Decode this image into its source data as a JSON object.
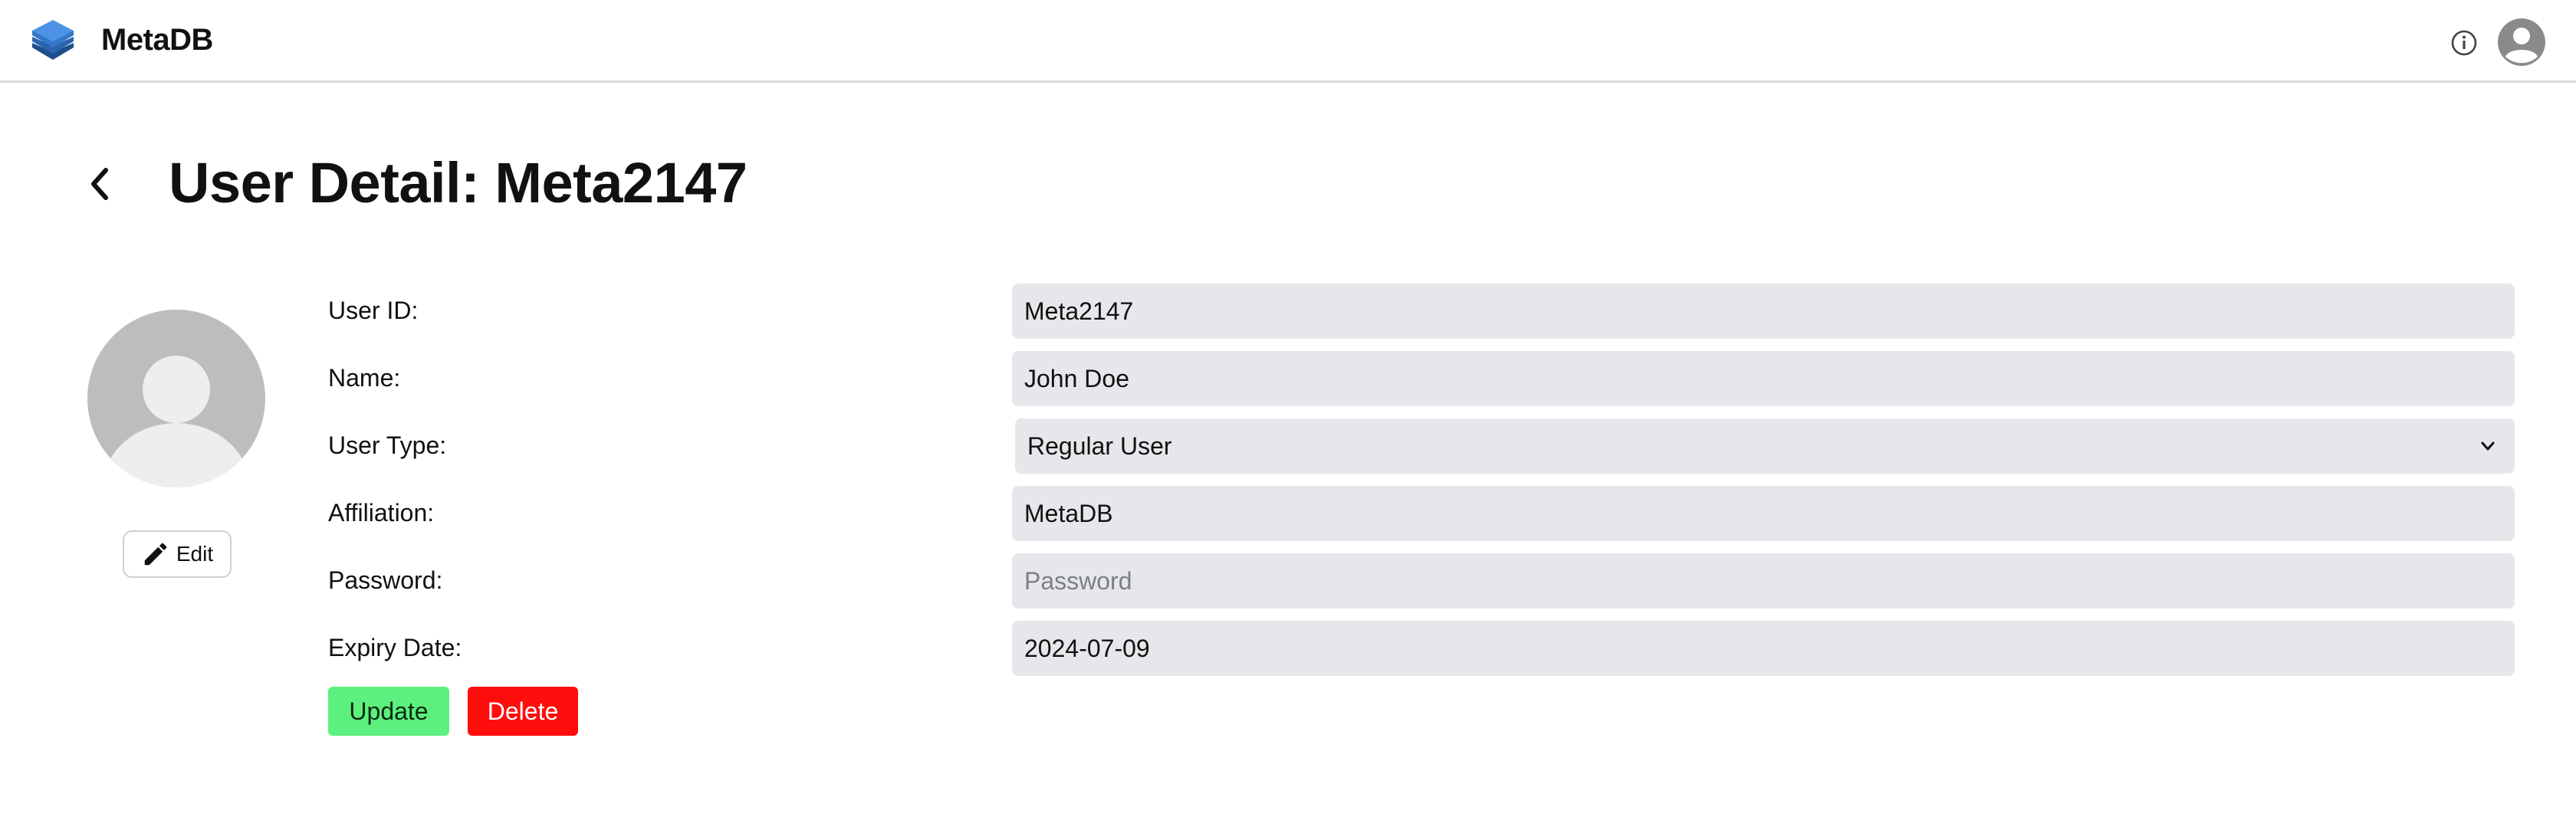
{
  "app": {
    "title": "MetaDB",
    "logo_icon": "layers-stack-icon",
    "brand_color": "#3a7bd5"
  },
  "header": {
    "info_icon": "info-circle-icon",
    "account_icon": "account-avatar-icon"
  },
  "page": {
    "title": "User Detail: Meta2147",
    "back_icon": "chevron-left-icon"
  },
  "profile": {
    "avatar_icon": "user-avatar-placeholder-icon",
    "edit_label": "Edit",
    "edit_icon": "pencil-icon"
  },
  "form": {
    "user_id": {
      "label": "User ID:",
      "value": "Meta2147"
    },
    "name": {
      "label": "Name:",
      "value": "John Doe"
    },
    "user_type": {
      "label": "User Type:",
      "value": "Regular User",
      "icon": "chevron-down-icon"
    },
    "affiliation": {
      "label": "Affiliation:",
      "value": "MetaDB"
    },
    "password": {
      "label": "Password:",
      "value": "",
      "placeholder": "Password"
    },
    "expiry_date": {
      "label": "Expiry Date:",
      "value": "2024-07-09"
    }
  },
  "actions": {
    "update_label": "Update",
    "delete_label": "Delete",
    "update_color": "#5cf07f",
    "delete_color": "#ff0d0d"
  }
}
